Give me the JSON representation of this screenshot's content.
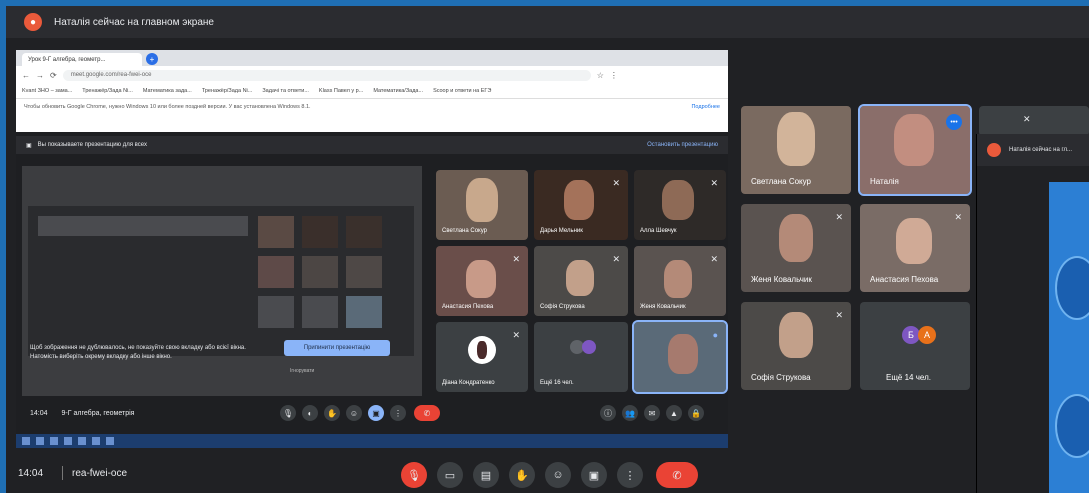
{
  "banner": {
    "text": "Наталія сейчас на главном экране"
  },
  "browser": {
    "tab_title": "Урок 9-Г алгебра, геометр...",
    "url": "meet.google.com/rea-fwei-oce",
    "bookmarks": [
      "Kvant ЗНО – зама...",
      "Тренажёр/Зада Ni...",
      "Математика зада...",
      "Тренажёр/Зада Ni...",
      "Задачі та ответи...",
      "Klass Павел у р...",
      "Математика/Зада...",
      "Scoop и ответи на ЕГЭ"
    ],
    "info_text": "Чтобы обновить Google Chrome, нужно Windows 10 или более поздней версии. У вас установлена Windows 8.1.",
    "info_link": "Подробнее"
  },
  "present_bar": {
    "left": "Вы показываете презентацию для всех",
    "right": "Остановить презентацию"
  },
  "screen": {
    "message": "Щоб зображення не дублювалось, не показуйте свою вкладку або всієї вікна. Натомість виберіть окрему вкладку або інше вікно.",
    "button": "Припинити презентацію",
    "sub": "Ігнорувати"
  },
  "inner_tiles": [
    {
      "name": "Светлана Сокур",
      "color": "#6b5c52"
    },
    {
      "name": "Дарья Мельник",
      "color": "#3a2a22"
    },
    {
      "name": "Алла Шевчук",
      "color": "#2e2a28"
    },
    {
      "name": "Анастасия Пехова",
      "color": "#6a4e4a"
    },
    {
      "name": "Софія Струкова",
      "color": "#4c4a48"
    },
    {
      "name": "Женя Ковальчик",
      "color": "#5a5350"
    },
    {
      "name": "Діана Кондратенко",
      "color": "#3c4043"
    },
    {
      "name": "Ещё 16 чел.",
      "color": "#3c4043"
    },
    {
      "name": "",
      "color": "#5a6a78"
    }
  ],
  "inner_bar": {
    "time": "14:04",
    "title": "9-Г алгебра, геометрія"
  },
  "right_tiles": [
    {
      "name": "Светлана Сокур",
      "color": "#7a6a60"
    },
    {
      "name": "Наталія",
      "color": "#8a6e6a"
    },
    {
      "name": "Женя Ковальчик",
      "color": "#5a5350"
    },
    {
      "name": "Анастасия Пехова",
      "color": "#7a6c66"
    },
    {
      "name": "Софія Струкова",
      "color": "#4c4a48"
    },
    {
      "name": "Ещё 14 чел.",
      "color": "#3c4043"
    }
  ],
  "overflow": {
    "banner": "Наталія сейчас на гл..."
  },
  "bottom": {
    "time": "14:04",
    "code": "rea-fwei-oce"
  },
  "avatars": {
    "a1": "Б",
    "a2": "А"
  }
}
